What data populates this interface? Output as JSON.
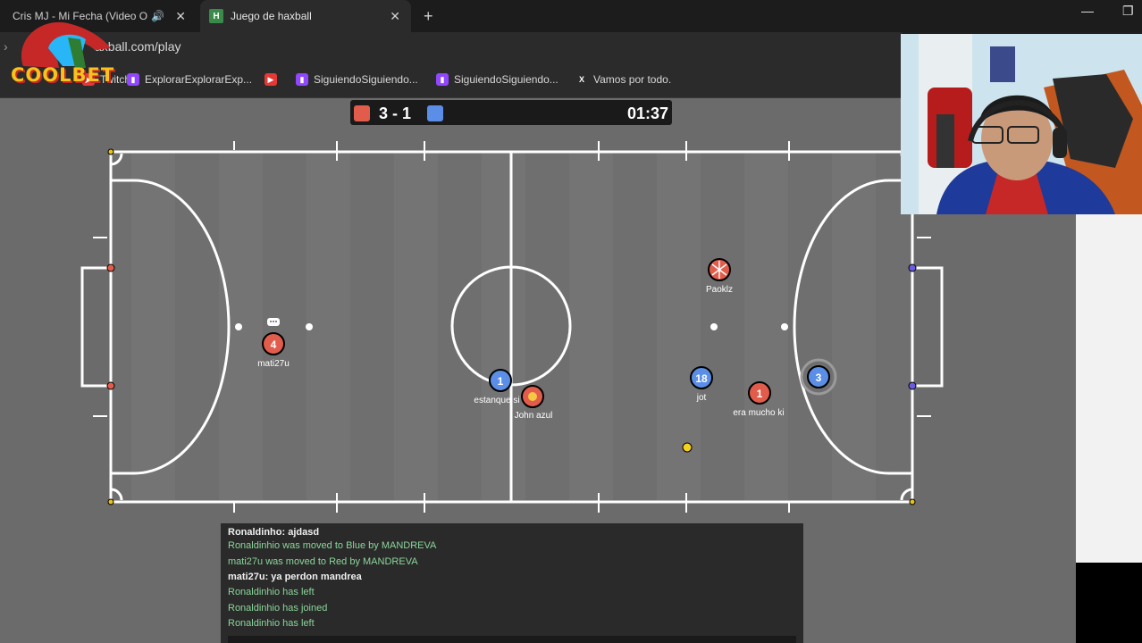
{
  "browser": {
    "tabs": [
      {
        "label": "Cris MJ - Mi Fecha (Video O",
        "active": false,
        "audio": true
      },
      {
        "label": "Juego de haxball",
        "active": true
      }
    ],
    "url": "axball.com/play",
    "bookmarks": [
      {
        "label": "Twitch",
        "icon": "youtube-icon"
      },
      {
        "label": "ExplorarExplorarExp...",
        "icon": "twitch-icon"
      },
      {
        "label": "",
        "icon": "youtube-icon"
      },
      {
        "label": "SiguiendoSiguiendo...",
        "icon": "twitch-icon"
      },
      {
        "label": "SiguiendoSiguiendo...",
        "icon": "twitch-icon"
      },
      {
        "label": "Vamos por todo.",
        "icon": "x-icon"
      }
    ]
  },
  "overlay": {
    "brand": "COOLBET"
  },
  "scoreboard": {
    "score": "3 - 1",
    "time": "01:37",
    "red_color": "#e25c4b",
    "blue_color": "#5b8ee6"
  },
  "players": [
    {
      "name": "mati27u",
      "number": "4",
      "team": "red"
    },
    {
      "name": "estanque si",
      "number": "1",
      "team": "blue"
    },
    {
      "name": "John  azul",
      "number": "",
      "team": "red"
    },
    {
      "name": "Paoklz",
      "number": "",
      "team": "red"
    },
    {
      "name": "jot",
      "number": "18",
      "team": "blue"
    },
    {
      "name": "era mucho ki",
      "number": "1",
      "team": "red"
    },
    {
      "name": "",
      "number": "3",
      "team": "blue"
    }
  ],
  "chat": [
    {
      "text": "Ronaldinho: ajdasd",
      "type": "user"
    },
    {
      "text": "Ronaldinhio was moved to Blue by MANDREVA",
      "type": "system"
    },
    {
      "text": "mati27u was moved to Red by MANDREVA",
      "type": "system"
    },
    {
      "text": "mati27u: ya perdon mandrea",
      "type": "user"
    },
    {
      "text": "Ronaldinhio has left",
      "type": "system"
    },
    {
      "text": "Ronaldinhio has joined",
      "type": "system"
    },
    {
      "text": "Ronaldinhio has left",
      "type": "system"
    }
  ]
}
